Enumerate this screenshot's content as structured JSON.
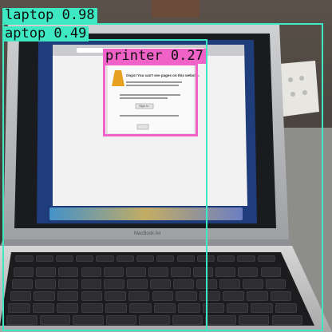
{
  "colors": {
    "laptop": "#3ee8c2",
    "printer": "#f062c8",
    "label_text": "#111111"
  },
  "detections": [
    {
      "label": "laptop",
      "score": "0.98",
      "text": "laptop 0.98"
    },
    {
      "label": "laptop",
      "score": "0.49",
      "text": "aptop 0.49"
    },
    {
      "label": "printer",
      "score": "0.27",
      "text": "printer 0.27"
    }
  ],
  "laptop": {
    "brand_text": "MacBook Air"
  },
  "screen": {
    "error_title": "Oops! You can't see pages on this website.",
    "button_label": "Sign In"
  }
}
